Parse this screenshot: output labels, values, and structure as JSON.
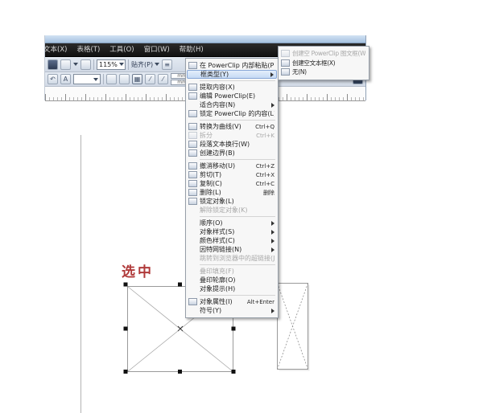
{
  "window": {
    "menu_bar": {
      "items": [
        {
          "name": "menu-text",
          "label": "文本(X)"
        },
        {
          "name": "menu-table",
          "label": "表格(T)"
        },
        {
          "name": "menu-tools",
          "label": "工具(O)"
        },
        {
          "name": "menu-window",
          "label": "窗口(W)"
        },
        {
          "name": "menu-help",
          "label": "帮助(H)"
        }
      ]
    },
    "standard_bar": {
      "zoom_value": "115%",
      "snap_label": "贴齐(P)",
      "icons_left": [
        {
          "name": "import-icon",
          "glyph": ""
        },
        {
          "name": "export-icon",
          "glyph": ""
        },
        {
          "name": "application-launcher-icon",
          "glyph": ""
        }
      ],
      "options_icon": "options-icon"
    },
    "property_bar": {
      "unit": "mm",
      "icons": [
        {
          "name": "rotate-icon",
          "glyph": "↶"
        },
        {
          "name": "text-style-icon",
          "glyph": "A"
        },
        {
          "name": "mirror-horizontal-icon",
          "glyph": ""
        },
        {
          "name": "mirror-vertical-icon",
          "glyph": ""
        },
        {
          "name": "frame-grid-icon",
          "glyph": ""
        },
        {
          "name": "skew-icon",
          "glyph": ""
        },
        {
          "name": "corner-icon",
          "glyph": ""
        }
      ]
    }
  },
  "context_menu": {
    "items": [
      {
        "name": "paste-into-powerclip",
        "icon": "paste-icon",
        "label": "在 PowerClip 内部粘贴(P)..."
      },
      {
        "name": "frame-type",
        "label": "框类型(Y)",
        "submenu": true,
        "highlighted": true
      },
      {
        "separator": true
      },
      {
        "name": "extract-contents",
        "icon": "extract-contents-icon",
        "label": "提取内容(X)"
      },
      {
        "name": "edit-powerclip",
        "icon": "edit-powerclip-icon",
        "label": "编辑 PowerClip(E)"
      },
      {
        "name": "fit-contents",
        "label": "适合内容(N)",
        "submenu": true
      },
      {
        "name": "lock-powerclip-contents",
        "icon": "lock-contents-icon",
        "label": "锁定 PowerClip 的内容(L)"
      },
      {
        "separator": true
      },
      {
        "name": "convert-to-curves",
        "icon": "convert-curves-icon",
        "label": "转换为曲线(V)",
        "shortcut": "Ctrl+Q"
      },
      {
        "name": "break-apart",
        "icon": "break-apart-icon",
        "label": "拆分",
        "shortcut": "Ctrl+K",
        "disabled": true
      },
      {
        "name": "wrap-paragraph-text",
        "icon": "wrap-text-icon",
        "label": "段落文本换行(W)"
      },
      {
        "name": "create-boundary",
        "icon": "boundary-icon",
        "label": "创建边界(B)"
      },
      {
        "separator": true
      },
      {
        "name": "undo-move",
        "icon": "undo-icon",
        "label": "撤消移动(U)",
        "shortcut": "Ctrl+Z"
      },
      {
        "name": "cut",
        "icon": "cut-icon",
        "label": "剪切(T)",
        "shortcut": "Ctrl+X"
      },
      {
        "name": "copy",
        "icon": "copy-icon",
        "label": "复制(C)",
        "shortcut": "Ctrl+C"
      },
      {
        "name": "delete",
        "icon": "delete-icon",
        "label": "删除(L)",
        "shortcut": "删除"
      },
      {
        "name": "lock-object",
        "icon": "lock-icon",
        "label": "锁定对象(L)"
      },
      {
        "name": "unlock-object",
        "label": "解除锁定对象(K)",
        "disabled": true
      },
      {
        "separator": true
      },
      {
        "name": "order",
        "label": "顺序(O)",
        "submenu": true
      },
      {
        "name": "object-styles",
        "label": "对象样式(S)",
        "submenu": true
      },
      {
        "name": "color-styles",
        "label": "颜色样式(C)",
        "submenu": true
      },
      {
        "name": "internet-links",
        "label": "因特网链接(N)",
        "submenu": true
      },
      {
        "name": "jump-to-hyperlink",
        "label": "跳转到浏览器中的超链接(J)",
        "disabled": true
      },
      {
        "separator": true
      },
      {
        "name": "overprint-fill",
        "label": "叠印填充(F)",
        "disabled": true
      },
      {
        "name": "overprint-outline",
        "label": "叠印轮廓(O)"
      },
      {
        "name": "object-hinting",
        "label": "对象提示(H)"
      },
      {
        "separator": true
      },
      {
        "name": "object-properties",
        "icon": "properties-icon",
        "label": "对象属性(I)",
        "shortcut": "Alt+Enter"
      },
      {
        "name": "symbol",
        "label": "符号(Y)",
        "submenu": true
      }
    ]
  },
  "frame_type_submenu": {
    "items": [
      {
        "name": "create-empty-powerclip-frame",
        "icon": "powerclip-frame-icon",
        "label": "创建空 PowerClip 图文框(W)",
        "disabled": true
      },
      {
        "name": "create-empty-text-frame",
        "icon": "text-frame-icon",
        "label": "创建空文本框(X)"
      },
      {
        "name": "none-frame-type",
        "icon": "none-icon",
        "label": "无(N)"
      }
    ]
  },
  "canvas": {
    "label_text": "选中",
    "objects": [
      {
        "name": "selected-empty-powerclip-frame",
        "type": "empty-frame",
        "selected": true
      },
      {
        "name": "empty-powerclip-frame-right",
        "type": "empty-frame",
        "selected": false
      }
    ]
  },
  "colors": {
    "selection_text_red": "#b03a3a",
    "menu_highlight": "#cfe0f5",
    "menubar_bg": "#1c1c1c",
    "toolbar_bg": "#d8dfe9",
    "title_bar": "#b9cfe8"
  }
}
